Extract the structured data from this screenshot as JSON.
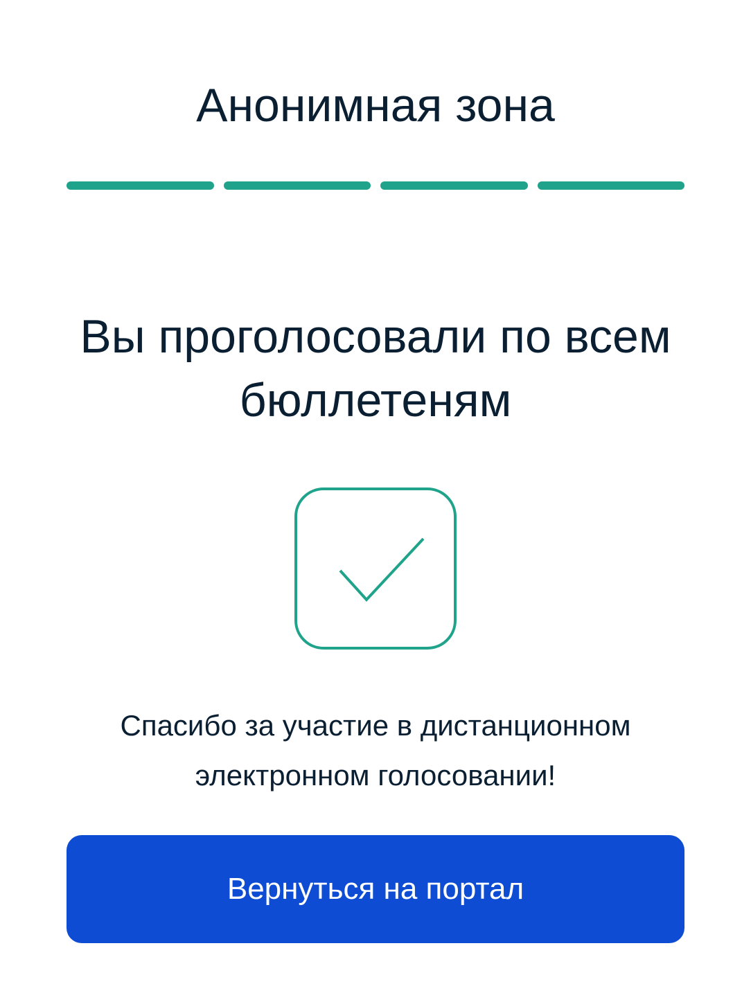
{
  "header": {
    "title": "Анонимная зона"
  },
  "progress": {
    "total_steps": 4,
    "completed_steps": 4,
    "color": "#1fa38a"
  },
  "main": {
    "headline": "Вы проголосовали по всем бюллетеням",
    "status_icon": "checkmark-square-icon",
    "icon_color": "#1fa38a",
    "message": "Спасибо за участие в дистанционном электронном голосовании!"
  },
  "actions": {
    "return_label": "Вернуться на портал",
    "button_color": "#0d4cd3"
  }
}
